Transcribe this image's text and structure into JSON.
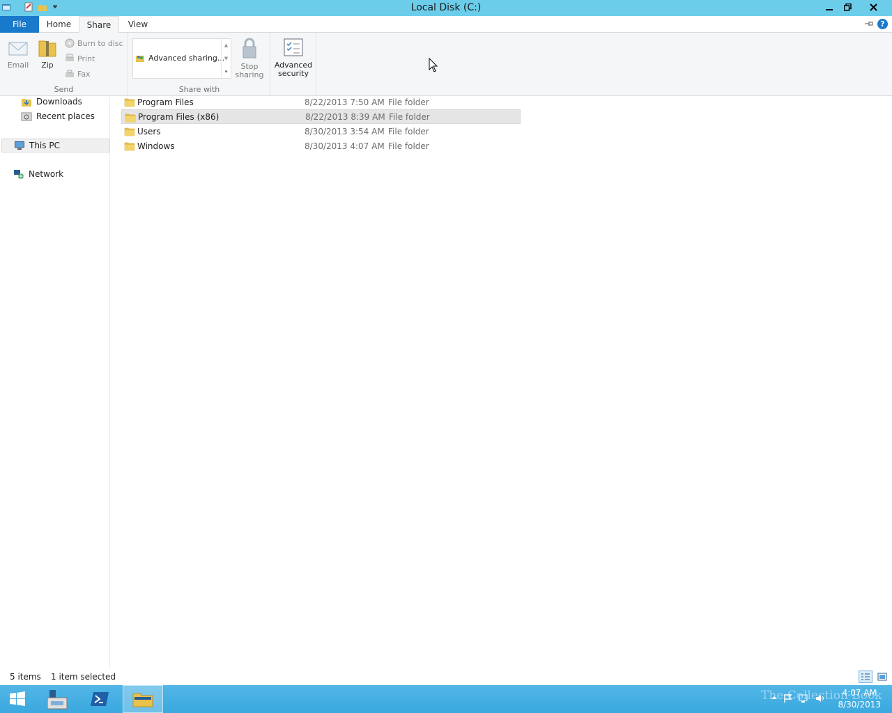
{
  "window": {
    "title": "Local Disk (C:)"
  },
  "ribbon_tabs": [
    "File",
    "Home",
    "Share",
    "View"
  ],
  "ribbon": {
    "send": {
      "label": "Send",
      "email": "Email",
      "zip": "Zip",
      "burn": "Burn to disc",
      "print": "Print",
      "fax": "Fax"
    },
    "share_with": {
      "label": "Share with",
      "gallery_item": "Advanced sharing...",
      "stop_sharing_line1": "Stop",
      "stop_sharing_line2": "sharing"
    },
    "security": {
      "line1": "Advanced",
      "line2": "security"
    }
  },
  "nav": {
    "downloads": "Downloads",
    "recent": "Recent places",
    "this_pc": "This PC",
    "network": "Network"
  },
  "files": [
    {
      "name": "Program Files",
      "date": "8/22/2013 7:50 AM",
      "type": "File folder"
    },
    {
      "name": "Program Files (x86)",
      "date": "8/22/2013 8:39 AM",
      "type": "File folder"
    },
    {
      "name": "Users",
      "date": "8/30/2013 3:54 AM",
      "type": "File folder"
    },
    {
      "name": "Windows",
      "date": "8/30/2013 4:07 AM",
      "type": "File folder"
    }
  ],
  "status": {
    "count": "5 items",
    "selected": "1 item selected"
  },
  "taskbar": {
    "time": "4:07 AM",
    "date": "8/30/2013",
    "watermark": "The Collection Book"
  },
  "colors": {
    "titlebar": "#6ccdeb",
    "file_tab": "#1979ca",
    "taskbar": "#3aa8df"
  }
}
